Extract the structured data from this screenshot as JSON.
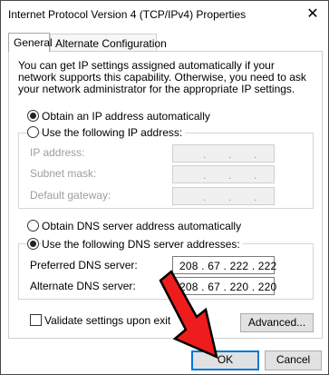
{
  "window": {
    "title": "Internet Protocol Version 4 (TCP/IPv4) Properties",
    "close_glyph": "✕"
  },
  "tabs": [
    {
      "label": "General",
      "active": true
    },
    {
      "label": "Alternate Configuration",
      "active": false
    }
  ],
  "description": "You can get IP settings assigned automatically if your network supports this capability. Otherwise, you need to ask your network administrator for the appropriate IP settings.",
  "ip": {
    "auto_label": "Obtain an IP address automatically",
    "auto_selected": true,
    "manual_label": "Use the following IP address:",
    "manual_selected": false,
    "fields": [
      {
        "label": "IP address:",
        "value": ""
      },
      {
        "label": "Subnet mask:",
        "value": ""
      },
      {
        "label": "Default gateway:",
        "value": ""
      }
    ]
  },
  "dns": {
    "auto_label": "Obtain DNS server address automatically",
    "auto_selected": false,
    "manual_label": "Use the following DNS server addresses:",
    "manual_selected": true,
    "preferred_label": "Preferred DNS server:",
    "preferred_value": "208 . 67 . 222 . 222",
    "alternate_label": "Alternate DNS server:",
    "alternate_value": "208 . 67 . 220 . 220"
  },
  "validate": {
    "label": "Validate settings upon exit",
    "checked": false
  },
  "buttons": {
    "advanced": "Advanced...",
    "ok": "OK",
    "cancel": "Cancel"
  },
  "colors": {
    "focus_border": "#0078d7",
    "arrow_fill": "#ee1c1c",
    "disabled_text": "#9e9e9e"
  },
  "annotation": {
    "type": "red-arrow",
    "points_to": "ok-button"
  }
}
